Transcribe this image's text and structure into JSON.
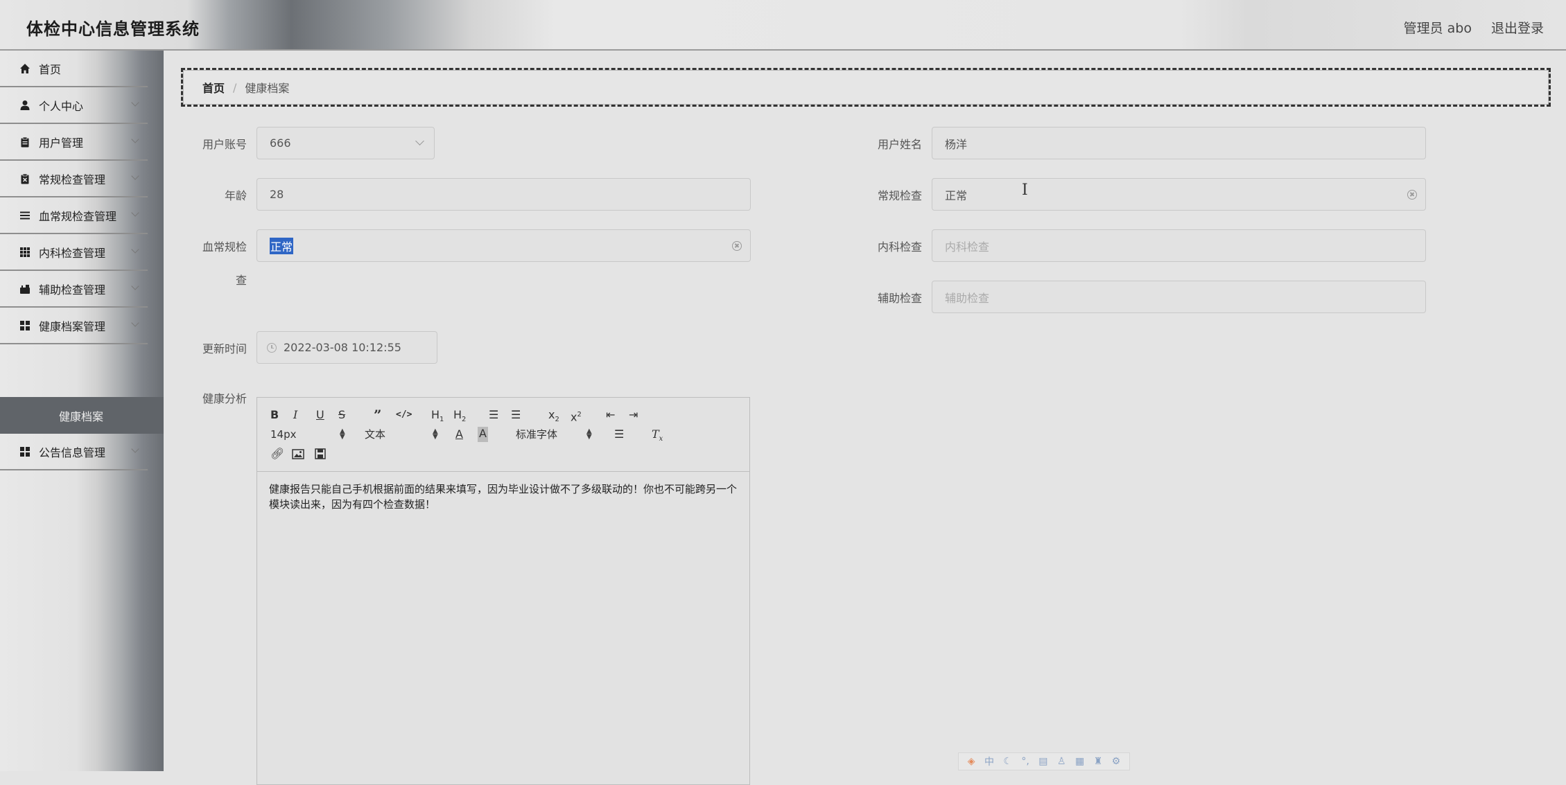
{
  "header": {
    "title": "体检中心信息管理系统",
    "user_label": "管理员 abo",
    "logout_label": "退出登录"
  },
  "sidebar": {
    "items": [
      {
        "label": "首页",
        "icon": "home-icon",
        "expandable": false
      },
      {
        "label": "个人中心",
        "icon": "user-icon",
        "expandable": true
      },
      {
        "label": "用户管理",
        "icon": "clipboard-icon",
        "expandable": true
      },
      {
        "label": "常规检查管理",
        "icon": "clipboard-x-icon",
        "expandable": true
      },
      {
        "label": "血常规检查管理",
        "icon": "list-icon",
        "expandable": true
      },
      {
        "label": "内科检查管理",
        "icon": "grid-icon",
        "expandable": true
      },
      {
        "label": "辅助检查管理",
        "icon": "briefcase-icon",
        "expandable": true
      },
      {
        "label": "健康档案管理",
        "icon": "apps-icon",
        "expandable": true
      },
      {
        "label": "公告信息管理",
        "icon": "apps-icon",
        "expandable": true
      }
    ],
    "active_sub": "健康档案"
  },
  "breadcrumb": {
    "home": "首页",
    "separator": "/",
    "current": "健康档案"
  },
  "form": {
    "account_label": "用户账号",
    "account_value": "666",
    "name_label": "用户姓名",
    "name_value": "杨洋",
    "age_label": "年龄",
    "age_value": "28",
    "routine_label": "常规检查",
    "routine_value": "正常",
    "blood_label_1": "血常规检",
    "blood_label_2": "查",
    "blood_value": "正常",
    "internal_label": "内科检查",
    "internal_placeholder": "内科检查",
    "aux_label": "辅助检查",
    "aux_placeholder": "辅助检查",
    "update_label": "更新时间",
    "update_value": "2022-03-08 10:12:55",
    "analysis_label": "健康分析"
  },
  "editor": {
    "font_size": "14px",
    "block_type": "文本",
    "font_family": "标准字体",
    "content": "健康报告只能自己手机根据前面的结果来填写，因为毕业设计做不了多级联动的！你也不可能跨另一个模块读出来，因为有四个检查数据！"
  },
  "ime_bar": {
    "lang": "中"
  },
  "colors": {
    "selection": "#2f66c5",
    "active_sub_bg": "#606469"
  }
}
